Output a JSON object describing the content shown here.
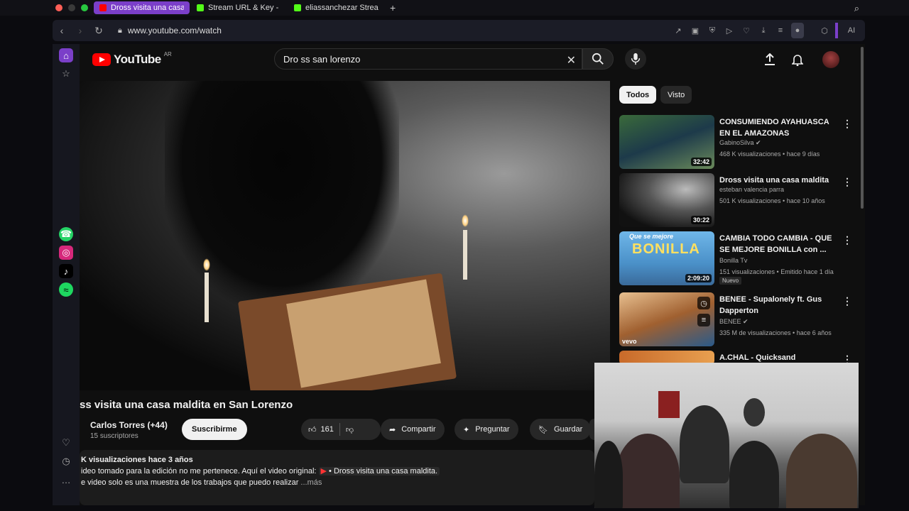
{
  "browser": {
    "tabs": [
      {
        "title": "Dross visita una casa m",
        "fav_color": "#ff0000",
        "active": true
      },
      {
        "title": "Stream URL & Key - Kick",
        "fav_color": "#53fc18",
        "active": false
      },
      {
        "title": "eliassanchezar Stream -",
        "fav_color": "#53fc18",
        "active": false
      }
    ],
    "new_tab": "+",
    "url": "www.youtube.com/watch",
    "ai_label": "AI"
  },
  "youtube": {
    "logo_text": "YouTube",
    "logo_region": "AR",
    "search_value": "Dro ss san lorenzo",
    "video_title": "ss visita una casa maldita en San Lorenzo",
    "channel_name": "Carlos Torres (+44)",
    "subscribers": "15 suscriptores",
    "subscribe_label": "Suscribirme",
    "likes": "161",
    "share_label": "Compartir",
    "ask_label": "Preguntar",
    "save_label": "Guardar",
    "desc_stats": "K visualizaciones  hace 3 años",
    "desc_line1_prefix": "ideo tomado para la edición no me pertenece. Aquí el video original:",
    "desc_line1_link": "• Dross visita una casa maldita.",
    "desc_line2": "e video solo es una muestra de los trabajos que puedo realizar",
    "desc_more": "...más",
    "chips": [
      "Todos",
      "Visto"
    ],
    "related": [
      {
        "title": "CONSUMIENDO AYAHUASCA EN EL AMAZONAS",
        "channel": "GabinoSilva",
        "meta": "468 K visualizaciones • hace 9 días",
        "duration": "32:42",
        "verified": true
      },
      {
        "title": "Dross visita una casa maldita",
        "channel": "esteban valencia parra",
        "meta": "501 K visualizaciones • hace 10 años",
        "duration": "30:22",
        "verified": false
      },
      {
        "title": "CAMBIA TODO CAMBIA - QUE SE MEJORE BONILLA con ...",
        "channel": "Bonilla Tv",
        "meta": "151 visualizaciones • Emitido hace 1 día",
        "duration": "2:09:20",
        "badge": "Nuevo",
        "thumb_text": "Que se mejore",
        "thumb_text2": "BONILLA",
        "verified": false
      },
      {
        "title": "BENEE - Supalonely ft. Gus Dapperton",
        "channel": "BENEE",
        "meta": "335 M de visualizaciones • hace 6 años",
        "duration": "",
        "thumb_text": "vevo",
        "verified": true
      },
      {
        "title": "A.CHAL - Quicksand",
        "channel": "",
        "meta": "",
        "duration": "",
        "verified": false
      }
    ]
  }
}
